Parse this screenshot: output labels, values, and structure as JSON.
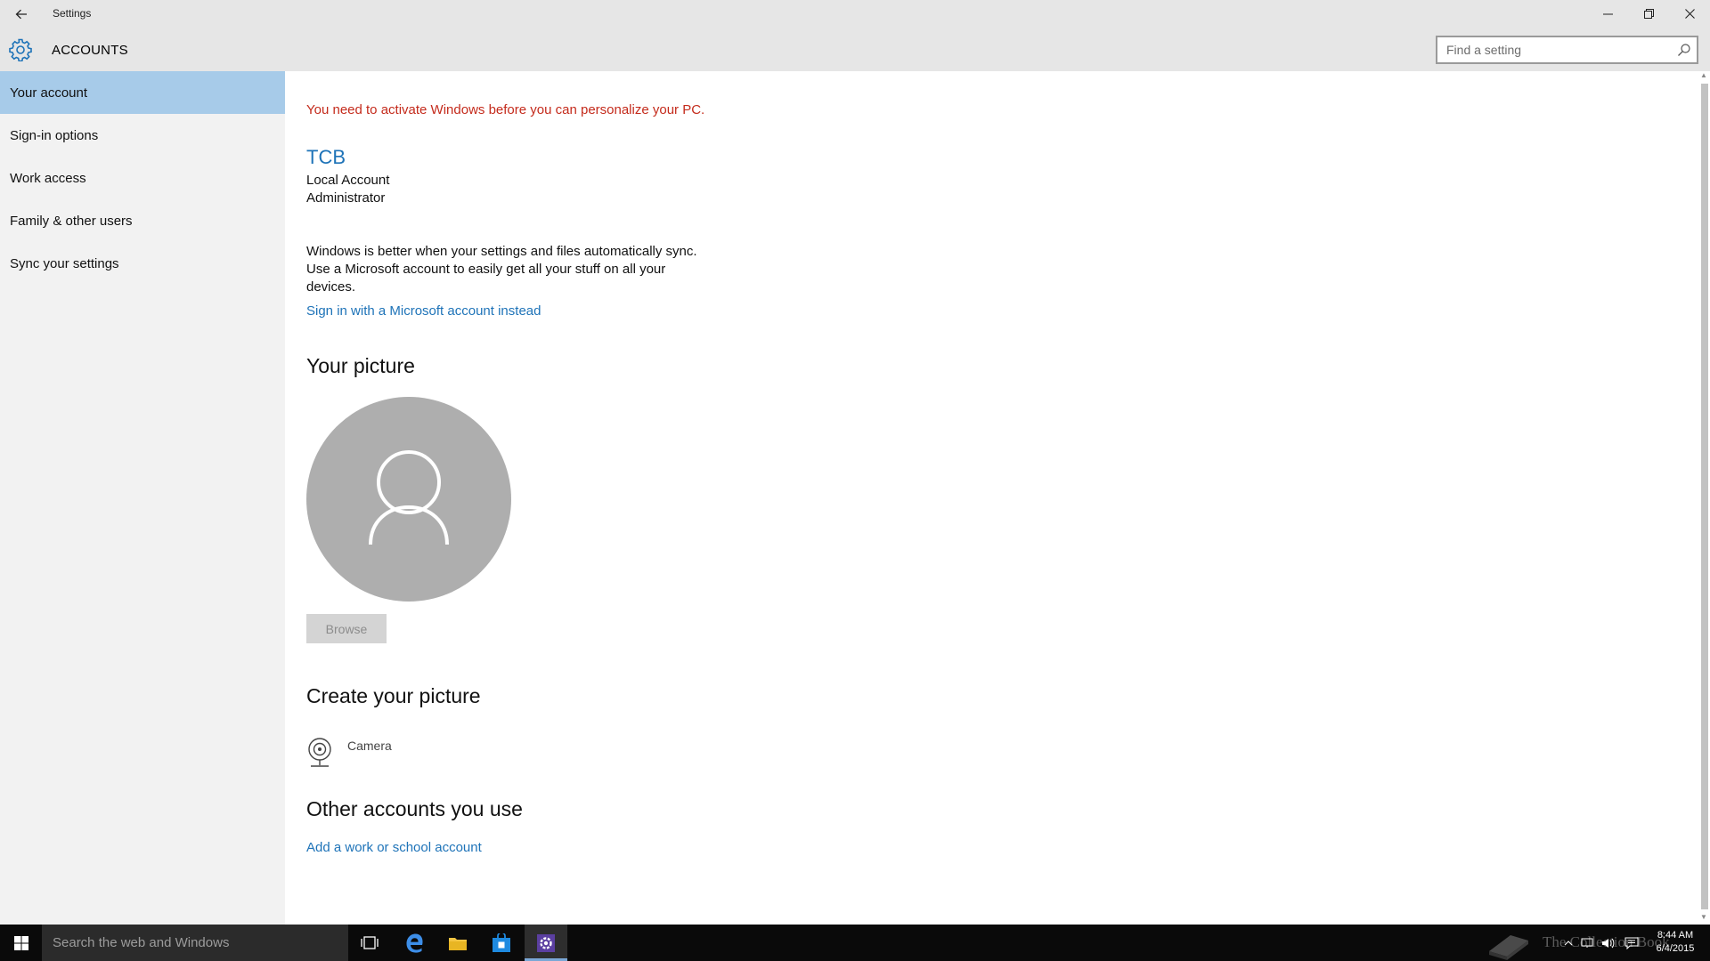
{
  "window": {
    "title": "Settings",
    "controls": [
      "minimize",
      "restore",
      "close"
    ]
  },
  "header": {
    "section_title": "ACCOUNTS",
    "search_placeholder": "Find a setting"
  },
  "sidebar": {
    "items": [
      {
        "label": "Your account",
        "selected": true
      },
      {
        "label": "Sign-in options",
        "selected": false
      },
      {
        "label": "Work access",
        "selected": false
      },
      {
        "label": "Family & other users",
        "selected": false
      },
      {
        "label": "Sync your settings",
        "selected": false
      }
    ]
  },
  "main": {
    "activation_warning": "You need to activate Windows before you can personalize your PC.",
    "account": {
      "name": "TCB",
      "type": "Local Account",
      "role": "Administrator"
    },
    "sync_description": "Windows is better when your settings and files automatically sync. Use a Microsoft account to easily get all your stuff on all your devices.",
    "microsoft_link": "Sign in with a Microsoft account instead",
    "your_picture_heading": "Your picture",
    "browse_button": "Browse",
    "create_picture_heading": "Create your picture",
    "camera_label": "Camera",
    "other_accounts_heading": "Other accounts you use",
    "work_account_link": "Add a work or school account"
  },
  "taskbar": {
    "search_text": "Search the web and Windows",
    "pinned": [
      "task-view-icon",
      "edge-icon",
      "file-explorer-icon",
      "store-icon",
      "settings-icon"
    ],
    "active_app": "settings-icon",
    "watermark_text": "The Collection Book",
    "clock_time": "8:44 AM",
    "clock_date": "6/4/2015"
  },
  "colors": {
    "titlebar_bg": "#e6e6e6",
    "sidebar_bg": "#f2f2f2",
    "selected_item_bg": "#a7cbe9",
    "accent_blue": "#1e73b8",
    "warning_red": "#c42b1c",
    "avatar_gray": "#aeaeae",
    "taskbar_bg": "#0a0a0a"
  }
}
